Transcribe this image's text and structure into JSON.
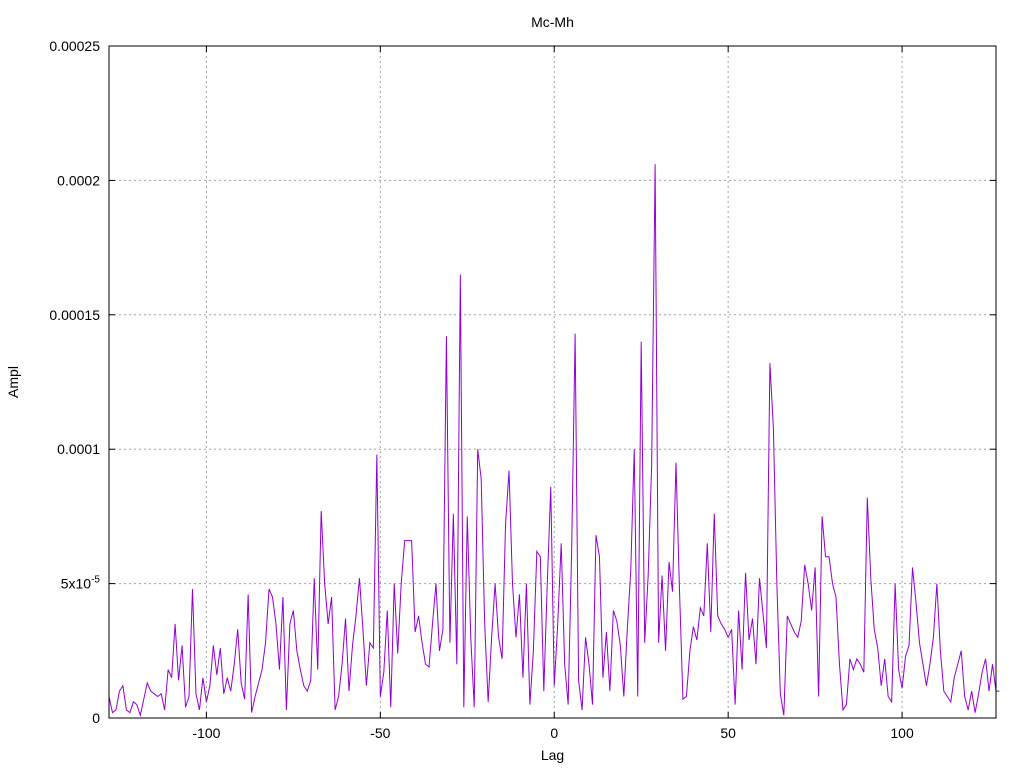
{
  "chart_data": {
    "type": "line",
    "title": "Mc-Mh",
    "xlabel": "Lag",
    "ylabel": "Ampl",
    "xlim": [
      -128,
      127
    ],
    "ylim": [
      0,
      0.00025
    ],
    "grid": true,
    "line_color": "#9400d3",
    "x_ticks": [
      {
        "value": -100,
        "label": "-100"
      },
      {
        "value": -50,
        "label": "-50"
      },
      {
        "value": 0,
        "label": "0"
      },
      {
        "value": 50,
        "label": "50"
      },
      {
        "value": 100,
        "label": "100"
      }
    ],
    "y_ticks": [
      {
        "value": 0,
        "label": "0"
      },
      {
        "value": 5e-05,
        "label": "5x10",
        "sup": "-5"
      },
      {
        "value": 0.0001,
        "label": "0.0001"
      },
      {
        "value": 0.00015,
        "label": "0.00015"
      },
      {
        "value": 0.0002,
        "label": "0.0002"
      },
      {
        "value": 0.00025,
        "label": "0.00025"
      }
    ],
    "series": [
      {
        "x_start": -128,
        "x_step": 1,
        "values": [
          8e-06,
          2e-06,
          3e-06,
          1e-05,
          1.2e-05,
          3e-06,
          2e-06,
          6e-06,
          5e-06,
          1e-06,
          7e-06,
          1.3e-05,
          1e-05,
          9e-06,
          8e-06,
          9e-06,
          3e-06,
          1.8e-05,
          1.5e-05,
          3.5e-05,
          1.4e-05,
          2.7e-05,
          4e-06,
          8e-06,
          4.8e-05,
          9e-06,
          3e-06,
          1.5e-05,
          6e-06,
          1.2e-05,
          2.7e-05,
          1.6e-05,
          2.6e-05,
          9e-06,
          1.5e-05,
          1e-05,
          2e-05,
          3.3e-05,
          1.3e-05,
          7e-06,
          4.6e-05,
          2e-06,
          8e-06,
          1.3e-05,
          1.8e-05,
          2.8e-05,
          4.8e-05,
          4.5e-05,
          3.5e-05,
          1.8e-05,
          4.5e-05,
          3e-06,
          3.5e-05,
          4e-05,
          2.5e-05,
          1.8e-05,
          1.2e-05,
          1e-05,
          1.4e-05,
          5.2e-05,
          1.8e-05,
          7.7e-05,
          5e-05,
          3.5e-05,
          4.5e-05,
          3e-06,
          8e-06,
          2e-05,
          3.7e-05,
          1e-05,
          2.7e-05,
          3.8e-05,
          5.2e-05,
          3.3e-05,
          1.2e-05,
          2.8e-05,
          2.6e-05,
          9.8e-05,
          8e-06,
          1.7e-05,
          4e-05,
          4e-06,
          5e-05,
          2.4e-05,
          5e-05,
          6.6e-05,
          6.6e-05,
          6.6e-05,
          3.2e-05,
          3.8e-05,
          2.8e-05,
          2e-05,
          1.9e-05,
          3.5e-05,
          5e-05,
          2.5e-05,
          3.3e-05,
          0.000142,
          2.8e-05,
          7.6e-05,
          2e-05,
          0.000165,
          4e-06,
          7.5e-05,
          3e-05,
          4e-06,
          0.0001,
          8.9e-05,
          3.5e-05,
          6e-06,
          3e-05,
          5e-05,
          3e-05,
          2.2e-05,
          7.2e-05,
          9.2e-05,
          5e-05,
          3e-05,
          4.6e-05,
          1.5e-05,
          5e-05,
          5e-06,
          2.5e-05,
          6.2e-05,
          6e-05,
          1e-05,
          5e-05,
          8.6e-05,
          1.2e-05,
          3.5e-05,
          6.5e-05,
          2e-05,
          5e-06,
          6.2e-05,
          0.000143,
          1.4e-05,
          3e-06,
          3e-05,
          2e-05,
          5e-06,
          6.8e-05,
          6e-05,
          1.5e-05,
          3.2e-05,
          1e-05,
          4e-05,
          3.6e-05,
          2.7e-05,
          8e-06,
          3.3e-05,
          5.5e-05,
          0.0001,
          8e-06,
          0.00014,
          2.8e-05,
          5.3e-05,
          9.4e-05,
          0.000206,
          2.8e-05,
          5.3e-05,
          2.5e-05,
          5.8e-05,
          4.7e-05,
          9.5e-05,
          4.8e-05,
          7e-06,
          8e-06,
          2.5e-05,
          3.4e-05,
          2.9e-05,
          4.1e-05,
          3.8e-05,
          6.5e-05,
          3.2e-05,
          7.6e-05,
          3.8e-05,
          3.5e-05,
          3.3e-05,
          3e-05,
          3.3e-05,
          5e-06,
          4e-05,
          1.8e-05,
          5.4e-05,
          2.9e-05,
          3.7e-05,
          2e-05,
          5.2e-05,
          3.9e-05,
          2.6e-05,
          0.000132,
          0.000108,
          5e-05,
          9e-06,
          1e-06,
          3.8e-05,
          3.5e-05,
          3.2e-05,
          3e-05,
          3.6e-05,
          5.7e-05,
          5e-05,
          4e-05,
          5.6e-05,
          8e-06,
          7.5e-05,
          6e-05,
          6e-05,
          5e-05,
          4.5e-05,
          2e-05,
          3e-06,
          5e-06,
          2.2e-05,
          1.8e-05,
          2.2e-05,
          2e-05,
          1.7e-05,
          8.2e-05,
          5.2e-05,
          3.3e-05,
          2.6e-05,
          1.2e-05,
          2.2e-05,
          8e-06,
          6e-06,
          5e-05,
          1.8e-05,
          1.1e-05,
          2.3e-05,
          2.7e-05,
          5.6e-05,
          4.3e-05,
          2.8e-05,
          2e-05,
          1.2e-05,
          2e-05,
          3e-05,
          5e-05,
          2.5e-05,
          1e-05,
          8e-06,
          6e-06,
          1.5e-05,
          2e-05,
          2.5e-05,
          8e-06,
          3e-06,
          1e-05,
          2e-06,
          9e-06,
          1.7e-05,
          2.2e-05,
          1e-05,
          2e-05,
          1e-05,
          1e-05
        ]
      }
    ]
  }
}
